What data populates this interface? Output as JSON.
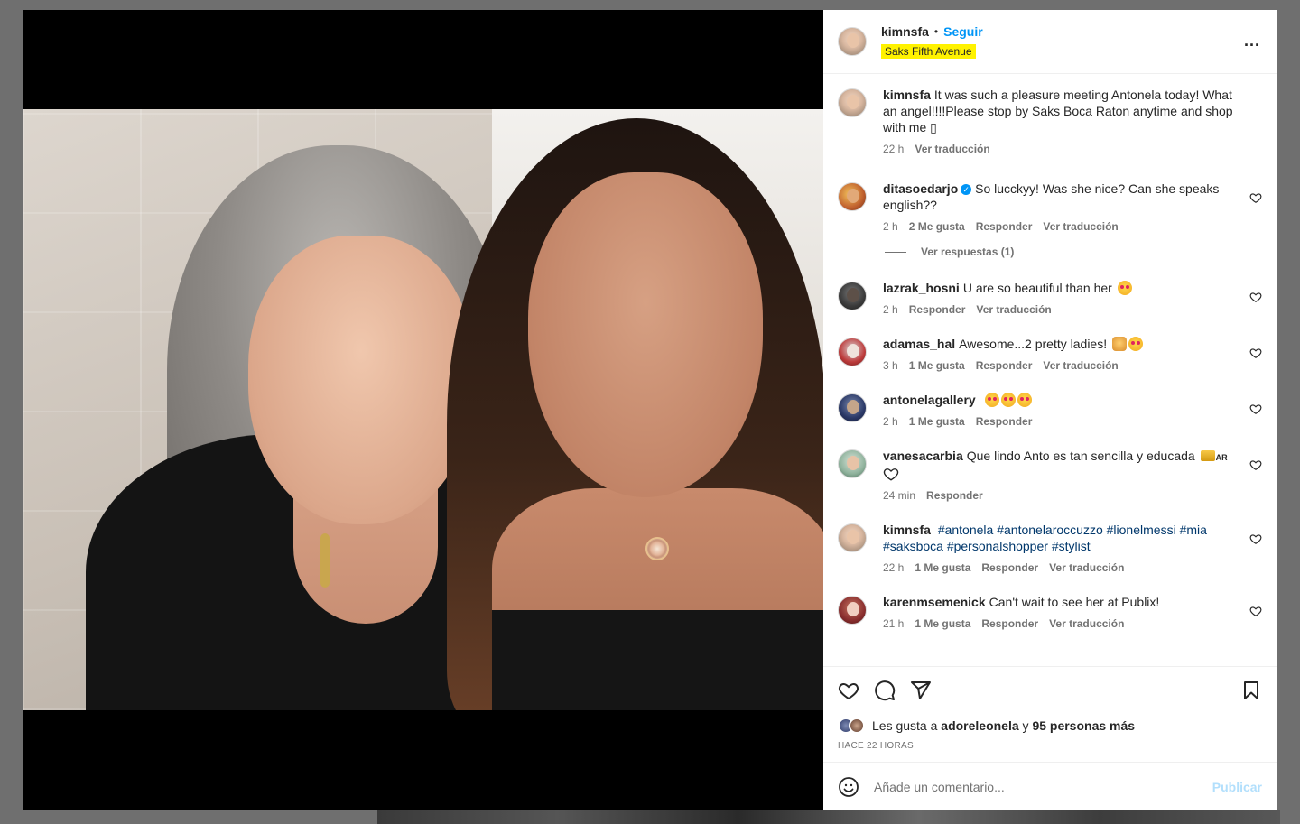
{
  "post": {
    "username": "kimnsfa",
    "dot": "•",
    "follow_label": "Seguir",
    "location": "Saks Fifth Avenue",
    "more_label": "..."
  },
  "caption": {
    "user": "kimnsfa",
    "text": "It was such a pleasure meeting Antonela today! What an angel!!!!Please stop by Saks Boca Raton anytime and shop with me ▯",
    "time": "22 h",
    "translate": "Ver traducción"
  },
  "comments": [
    {
      "user": "ditasoedarjo",
      "verified": true,
      "text": "So lucckyy! Was she nice? Can she speaks english??",
      "time": "2 h",
      "likes": "2 Me gusta",
      "reply": "Responder",
      "translate": "Ver traducción",
      "replies": "Ver respuestas (1)"
    },
    {
      "user": "lazrak_hosni",
      "text": "U are so beautiful than her",
      "time": "2 h",
      "reply": "Responder",
      "translate": "Ver traducción"
    },
    {
      "user": "adamas_hal",
      "text": "Awesome...2 pretty ladies!",
      "time": "3 h",
      "likes": "1 Me gusta",
      "reply": "Responder",
      "translate": "Ver traducción"
    },
    {
      "user": "antonelagallery",
      "text": "",
      "time": "2 h",
      "likes": "1 Me gusta",
      "reply": "Responder"
    },
    {
      "user": "vanesacarbia",
      "text": "Que lindo Anto es tan sencilla y educada",
      "flag": "AR",
      "time": "24 min",
      "reply": "Responder"
    },
    {
      "user": "kimnsfa",
      "tags": [
        "#antonela",
        "#antonelaroccuzzo",
        "#lionelmessi",
        "#mia",
        "#saksboca",
        "#personalshopper",
        "#stylist"
      ],
      "time": "22 h",
      "likes": "1 Me gusta",
      "reply": "Responder",
      "translate": "Ver traducción"
    },
    {
      "user": "karenmsemenick",
      "text": "Can't wait to see her at Publix!",
      "time": "21 h",
      "likes": "1 Me gusta",
      "reply": "Responder",
      "translate": "Ver traducción"
    }
  ],
  "likes": {
    "prefix": "Les gusta a",
    "user": "adoreleonela",
    "middle": "y",
    "others": "95 personas más"
  },
  "time_ago": "HACE 22 HORAS",
  "comment_input": {
    "placeholder": "Añade un comentario...",
    "post_label": "Publicar"
  },
  "icons": {
    "more": "more-horizontal-icon",
    "like": "heart-icon",
    "comment": "comment-bubble-icon",
    "share": "paper-plane-icon",
    "save": "bookmark-icon",
    "emoji": "smiley-icon"
  },
  "colors": {
    "follow": "#0095f6",
    "location_highlight": "#fff200",
    "hashtag": "#00376b",
    "meta": "#737373",
    "post_disabled": "#b2dffc"
  }
}
